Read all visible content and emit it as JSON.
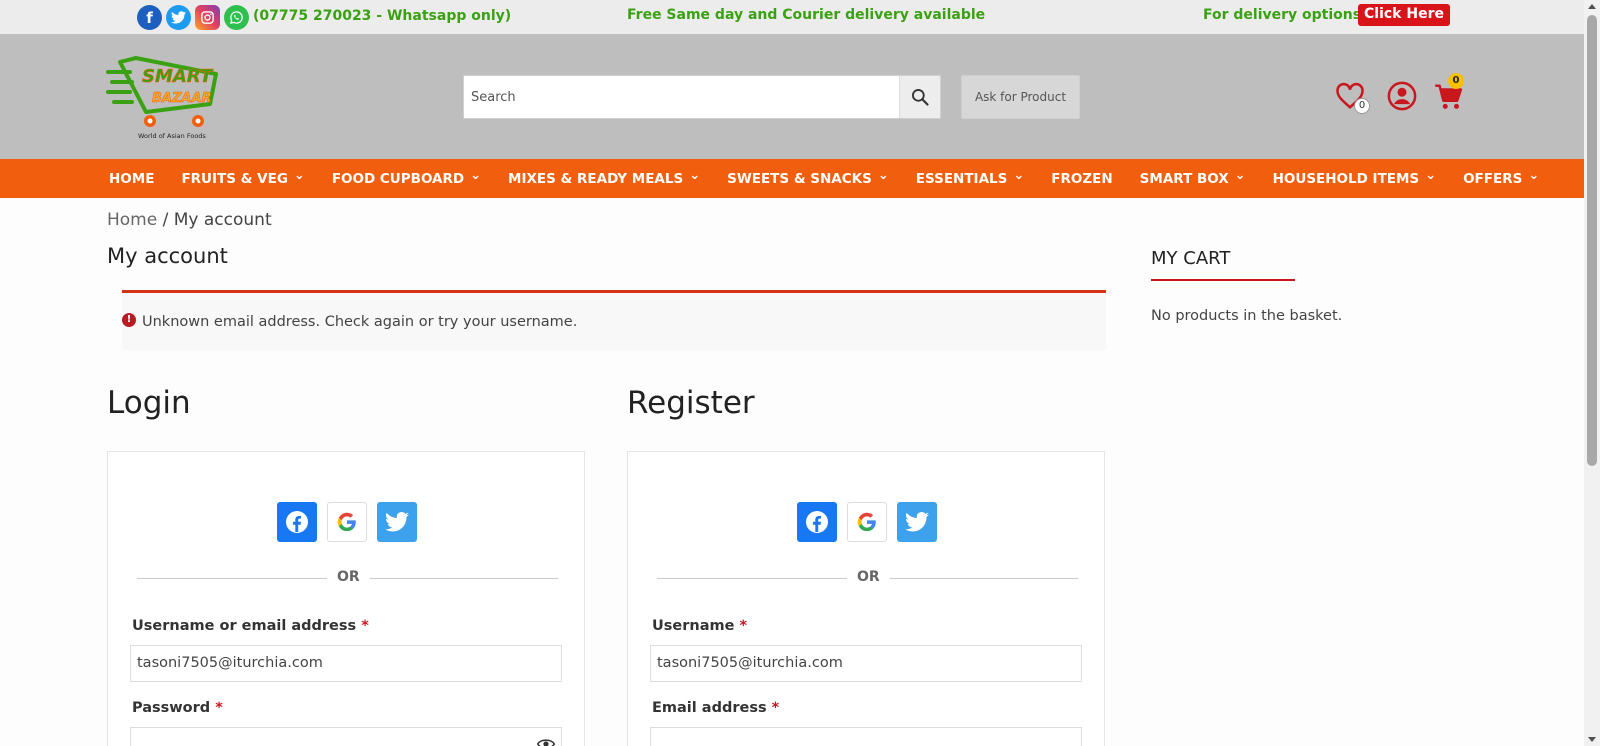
{
  "topbar": {
    "social_icons": [
      "facebook-icon",
      "twitter-icon",
      "instagram-icon",
      "whatsapp-icon"
    ],
    "phone": "(07775 270023 - Whatsapp only)",
    "free_delivery": "Free Same day and Courier delivery available",
    "delivery_options": "For delivery options",
    "click_here": "Click Here"
  },
  "header": {
    "logo_line1": "SMART",
    "logo_line2": "BAZAAR",
    "logo_tagline": "World of Asian Foods",
    "search_placeholder": "Search",
    "ask_for_product": "Ask for Product",
    "wishlist_count": "0",
    "cart_count": "0"
  },
  "nav": {
    "items": [
      {
        "label": "HOME",
        "dropdown": false
      },
      {
        "label": "FRUITS & VEG",
        "dropdown": true
      },
      {
        "label": "FOOD CUPBOARD",
        "dropdown": true
      },
      {
        "label": "MIXES & READY MEALS",
        "dropdown": true
      },
      {
        "label": "SWEETS & SNACKS",
        "dropdown": true
      },
      {
        "label": "ESSENTIALS",
        "dropdown": true
      },
      {
        "label": "FROZEN",
        "dropdown": false
      },
      {
        "label": "SMART BOX",
        "dropdown": true
      },
      {
        "label": "HOUSEHOLD ITEMS",
        "dropdown": true
      },
      {
        "label": "OFFERS",
        "dropdown": true
      }
    ]
  },
  "breadcrumb": {
    "home": "Home",
    "separator": "/",
    "current": "My account"
  },
  "page_title": "My account",
  "notice": {
    "message": "Unknown email address. Check again or try your username."
  },
  "login": {
    "heading": "Login",
    "or": "OR",
    "username_label": "Username or email address",
    "username_value": "tasoni7505@iturchia.com",
    "password_label": "Password",
    "required_mark": "*"
  },
  "register": {
    "heading": "Register",
    "or": "OR",
    "username_label": "Username",
    "username_value": "tasoni7505@iturchia.com",
    "email_label": "Email address",
    "required_mark": "*"
  },
  "cart": {
    "title": "MY CART",
    "empty_message": "No products in the basket."
  },
  "colors": {
    "nav_bg": "#f15e0d",
    "header_bg": "#bebebe",
    "topbar_green": "#3aa212",
    "accent_red": "#c9171e",
    "facebook_blue": "#1877f2",
    "twitter_blue": "#3ea1ec"
  }
}
